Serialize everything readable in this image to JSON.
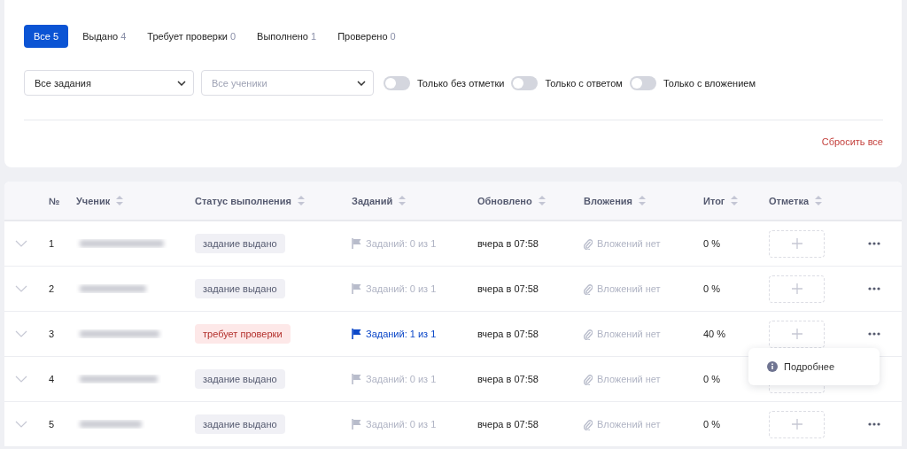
{
  "tabs": [
    {
      "label": "Все",
      "count": "5",
      "selected": true
    },
    {
      "label": "Выдано",
      "count": "4",
      "selected": false
    },
    {
      "label": "Требует проверки",
      "count": "0",
      "selected": false
    },
    {
      "label": "Выполнено",
      "count": "1",
      "selected": false
    },
    {
      "label": "Проверено",
      "count": "0",
      "selected": false
    }
  ],
  "filters": {
    "task_select": {
      "value": "Все задания"
    },
    "student_select": {
      "placeholder": "Все ученики"
    },
    "toggles": [
      {
        "label": "Только без отметки",
        "on": false
      },
      {
        "label": "Только с ответом",
        "on": false
      },
      {
        "label": "Только с вложением",
        "on": false
      }
    ],
    "reset": "Сбросить все"
  },
  "table": {
    "columns": [
      "№",
      "Ученик",
      "Статус выполнения",
      "Заданий",
      "Обновлено",
      "Вложения",
      "Итог",
      "Отметка"
    ],
    "rows": [
      {
        "number": "1",
        "status": {
          "label": "задание выдано",
          "kind": "issued"
        },
        "tasks": "Заданий: 0 из 1",
        "tasks_active": false,
        "updated": "вчера в 07:58",
        "attachments": "Вложений нет",
        "total": "0 %",
        "menu_open": false
      },
      {
        "number": "2",
        "status": {
          "label": "задание выдано",
          "kind": "issued"
        },
        "tasks": "Заданий: 0 из 1",
        "tasks_active": false,
        "updated": "вчера в 07:58",
        "attachments": "Вложений нет",
        "total": "0 %",
        "menu_open": false
      },
      {
        "number": "3",
        "status": {
          "label": "требует проверки",
          "kind": "review"
        },
        "tasks": "Заданий: 1 из 1",
        "tasks_active": true,
        "updated": "вчера в 07:58",
        "attachments": "Вложений нет",
        "total": "40 %",
        "menu_open": true
      },
      {
        "number": "4",
        "status": {
          "label": "задание выдано",
          "kind": "issued"
        },
        "tasks": "Заданий: 0 из 1",
        "tasks_active": false,
        "updated": "вчера в 07:58",
        "attachments": "Вложений нет",
        "total": "0 %",
        "menu_open": false
      },
      {
        "number": "5",
        "status": {
          "label": "задание выдано",
          "kind": "issued"
        },
        "tasks": "Заданий: 0 из 1",
        "tasks_active": false,
        "updated": "вчера в 07:58",
        "attachments": "Вложений нет",
        "total": "0 %",
        "menu_open": false
      }
    ]
  },
  "row_menu": {
    "items": [
      "Подробнее"
    ]
  }
}
